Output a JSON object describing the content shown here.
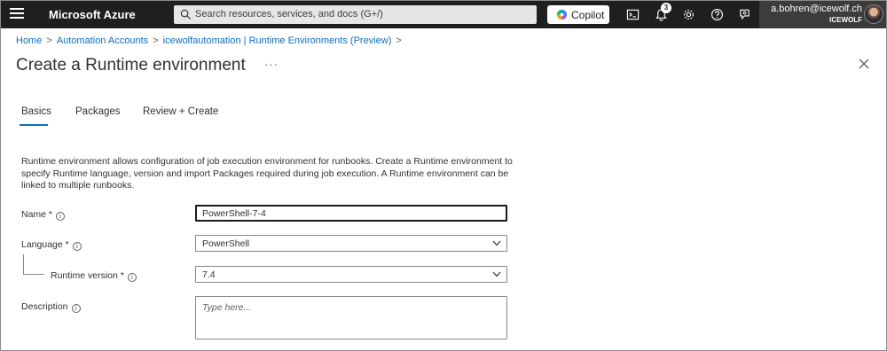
{
  "topbar": {
    "brand": "Microsoft Azure",
    "search_placeholder": "Search resources, services, and docs (G+/)",
    "copilot_label": "Copilot",
    "notification_count": "3",
    "account_email": "a.bohren@icewolf.ch",
    "account_tenant": "ICEWOLF",
    "icons": [
      "menu-icon",
      "search-icon",
      "copilot-icon",
      "cloud-shell-icon",
      "notifications-icon",
      "settings-icon",
      "help-icon",
      "feedback-icon",
      "avatar"
    ]
  },
  "breadcrumb": {
    "items": [
      "Home",
      "Automation Accounts",
      "icewolfautomation | Runtime Environments (Preview)"
    ],
    "separator": ">"
  },
  "page": {
    "title": "Create a Runtime environment",
    "more": "···"
  },
  "tabs": [
    {
      "label": "Basics",
      "selected": true
    },
    {
      "label": "Packages",
      "selected": false
    },
    {
      "label": "Review + Create",
      "selected": false
    }
  ],
  "intro": "Runtime environment allows configuration of job execution environment for runbooks. Create a Runtime environment to specify Runtime language, version and import Packages required during job execution. A Runtime environment can be linked to multiple runbooks.",
  "form": {
    "name": {
      "label": "Name *",
      "value": "PowerShell-7-4"
    },
    "language": {
      "label": "Language *",
      "value": "PowerShell"
    },
    "runtime_version": {
      "label": "Runtime version *",
      "value": "7.4"
    },
    "description": {
      "label": "Description",
      "placeholder": "Type here..."
    },
    "info_glyph": "i"
  },
  "colors": {
    "topbar": "#1f1f1f",
    "accent": "#0f6cbd"
  }
}
